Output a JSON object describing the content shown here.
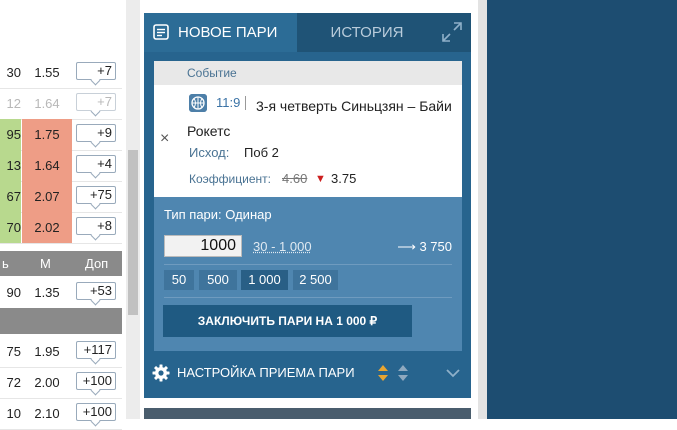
{
  "odds_table": {
    "rows": [
      {
        "c1": "30",
        "c2": "1.55",
        "c3": "+7",
        "style": ""
      },
      {
        "c1": "12",
        "c2": "1.64",
        "c3": "+7",
        "style": "faded"
      },
      {
        "c1": "95",
        "c2": "1.75",
        "c3": "+9",
        "style": "highlight"
      },
      {
        "c1": "13",
        "c2": "1.64",
        "c3": "+4",
        "style": "highlight"
      },
      {
        "c1": "67",
        "c2": "2.07",
        "c3": "+75",
        "style": "highlight"
      },
      {
        "c1": "70",
        "c2": "2.02",
        "c3": "+8",
        "style": "highlight"
      }
    ],
    "header": {
      "c1": "ь",
      "c2": "М",
      "c3": "Доп"
    },
    "rows2": [
      {
        "c1": "90",
        "c2": "1.35",
        "c3": "+53"
      }
    ],
    "rows3": [
      {
        "c1": "75",
        "c2": "1.95",
        "c3": "+117"
      },
      {
        "c1": "72",
        "c2": "2.00",
        "c3": "+100"
      },
      {
        "c1": "10",
        "c2": "2.10",
        "c3": "+100"
      }
    ]
  },
  "slip": {
    "tab_new": "НОВОЕ ПАРИ",
    "tab_history": "ИСТОРИЯ",
    "event_header": "Событие",
    "event_time": "11:9",
    "event_name": "3-я четверть Синьцзян – Байи Рокетс",
    "outcome_label": "Исход:",
    "outcome_value": "Поб 2",
    "coef_label": "Коэффициент:",
    "coef_old": "4.60",
    "coef_new": "3.75",
    "remove": "×",
    "bet_type": "Тип пари: Одинар",
    "stake_value": "1000",
    "stake_range": "30 - 1 000",
    "payout": "⟶ 3 750",
    "quick_stakes": [
      "50",
      "500",
      "1 000",
      "2 500"
    ],
    "place_bet": "ЗАКЛЮЧИТЬ ПАРИ НА 1 000 ₽",
    "settings": "НАСТРОЙКА ПРИЕМА ПАРИ"
  },
  "colors": {
    "panel": "#27648e",
    "tab_active": "#2c6c96",
    "form": "#4f86b0",
    "button": "#1f5a82",
    "odds_green": "#b8d98e",
    "odds_red": "#ee9d86",
    "arrow_down": "#cc1f1f",
    "sort_orange": "#e8a531"
  }
}
